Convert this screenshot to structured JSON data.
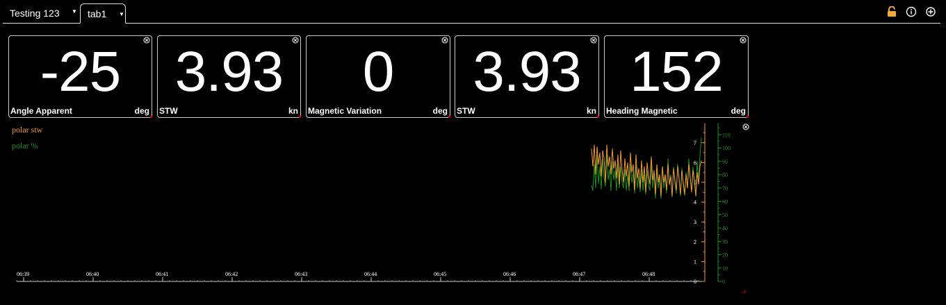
{
  "tabs": {
    "main": {
      "label": "Testing 123"
    },
    "active": {
      "label": "tab1"
    }
  },
  "toolbar": {
    "lock_icon": "unlocked-padlock-icon",
    "info_icon": "info-icon",
    "add_icon": "add-circle-icon"
  },
  "gauges": [
    {
      "value": "-25",
      "label": "Angle Apparent",
      "unit": "deg"
    },
    {
      "value": "3.93",
      "label": "STW",
      "unit": "kn"
    },
    {
      "value": "0",
      "label": "Magnetic Variation",
      "unit": "deg"
    },
    {
      "value": "3.93",
      "label": "STW",
      "unit": "kn"
    },
    {
      "value": "152",
      "label": "Heading Magnetic",
      "unit": "deg"
    }
  ],
  "colors": {
    "stw": "#f29a35",
    "percent": "#1f8f1f",
    "axis": "#cccccc",
    "accent": "#cc0000"
  },
  "chart_data": {
    "type": "line",
    "x_ticks": [
      "06:39",
      "06:40",
      "06:41",
      "06:42",
      "06:43",
      "06:44",
      "06:45",
      "06:46",
      "06:47",
      "06:48"
    ],
    "series": [
      {
        "name": "polar stw",
        "axis": "left",
        "ylim": [
          0,
          8
        ],
        "values": [
          6.7,
          5.8,
          6.9,
          5.4,
          6.8,
          5.9,
          6.5,
          5.3,
          6.6,
          6.2,
          5.0,
          6.9,
          5.8,
          6.3,
          5.4,
          6.7,
          5.7,
          6.1,
          5.2,
          6.4,
          4.9,
          6.6,
          5.6,
          5.0,
          6.2,
          5.3,
          6.0,
          4.8,
          6.5,
          5.5,
          5.9,
          4.6,
          6.4,
          5.2,
          5.7,
          4.7,
          6.1,
          5.0,
          5.8,
          4.5,
          6.0,
          5.3,
          4.9,
          6.3,
          5.1,
          5.6,
          4.4,
          5.9,
          5.0,
          5.4,
          4.3,
          5.8,
          5.0,
          5.4,
          4.6,
          5.9,
          4.9,
          5.3,
          4.3,
          5.7,
          5.1,
          4.6,
          5.8,
          5.2,
          4.4,
          5.6,
          5.0,
          4.4,
          5.4,
          4.7,
          5.9,
          5.2,
          4.5,
          5.6,
          5.1,
          4.3,
          5.5,
          4.9,
          5.8,
          6.1
        ]
      },
      {
        "name": "polar %",
        "axis": "right",
        "ylim": [
          0,
          115
        ],
        "values": [
          72,
          68,
          88,
          70,
          95,
          73,
          86,
          69,
          92,
          78,
          71,
          95,
          76,
          84,
          68,
          90,
          76,
          83,
          68,
          88,
          70,
          86,
          74,
          70,
          84,
          68,
          80,
          68,
          88,
          74,
          81,
          66,
          87,
          70,
          79,
          67,
          84,
          68,
          80,
          65,
          83,
          72,
          68,
          88,
          70,
          80,
          62,
          85,
          70,
          78,
          62,
          86,
          70,
          79,
          66,
          92,
          72,
          80,
          63,
          86,
          74,
          66,
          88,
          76,
          64,
          85,
          72,
          64,
          82,
          70,
          92,
          78,
          68,
          86,
          76,
          64,
          90,
          74,
          94,
          108
        ]
      }
    ],
    "legend": [
      "polar stw",
      "polar %"
    ],
    "left_ticks": [
      "0",
      "1",
      "2",
      "3",
      "4",
      "5",
      "6",
      "7"
    ],
    "right_ticks": [
      "0",
      "10",
      "20",
      "30",
      "40",
      "50",
      "60",
      "70",
      "80",
      "90",
      "100",
      "110"
    ]
  }
}
